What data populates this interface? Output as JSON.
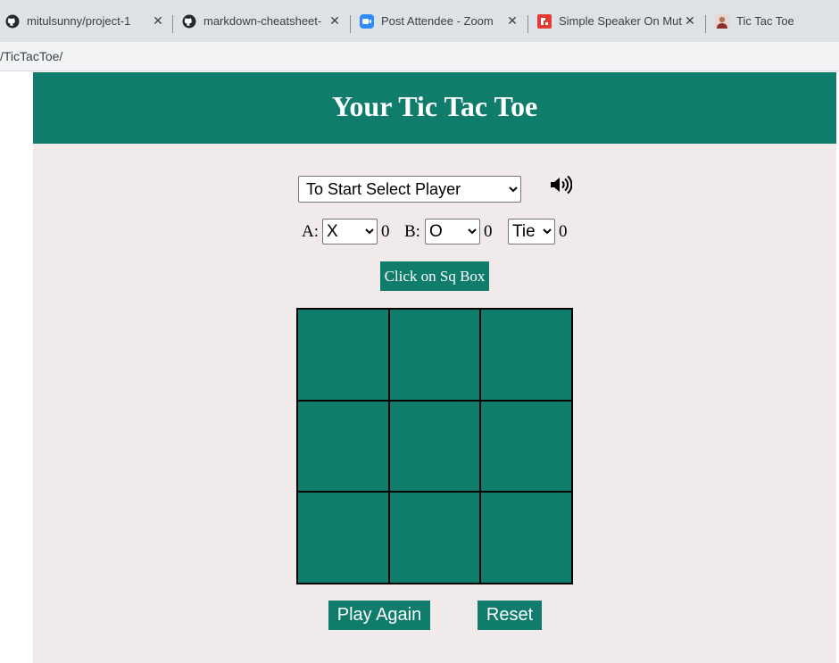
{
  "browser": {
    "tabs": [
      {
        "title": "mitulsunny/project-1",
        "icon": "github-icon",
        "closable": true
      },
      {
        "title": "markdown-cheatsheet-",
        "icon": "github-icon",
        "closable": true
      },
      {
        "title": "Post Attendee - Zoom",
        "icon": "zoom-icon",
        "closable": true
      },
      {
        "title": "Simple Speaker On Mut",
        "icon": "speaker-app-icon",
        "closable": true
      },
      {
        "title": "Tic Tac Toe",
        "icon": "avatar-icon",
        "closable": false
      }
    ],
    "url": "/TicTacToe/"
  },
  "page": {
    "title": "Your Tic Tac Toe",
    "player_select": {
      "selected": "To Start Select Player"
    },
    "sound_icon": "speaker-volume-icon",
    "score": {
      "a_label": "A:",
      "a_symbol": "X",
      "a_score": "0",
      "b_label": "B:",
      "b_symbol": "O",
      "b_score": "0",
      "tie_label": "Tie",
      "tie_score": "0"
    },
    "hint": "Click on Sq Box",
    "board": {
      "cells": [
        "",
        "",
        "",
        "",
        "",
        "",
        "",
        "",
        ""
      ]
    },
    "buttons": {
      "play_again": "Play Again",
      "reset": "Reset"
    }
  },
  "colors": {
    "accent": "#107c6c",
    "background": "#f0ebea"
  }
}
